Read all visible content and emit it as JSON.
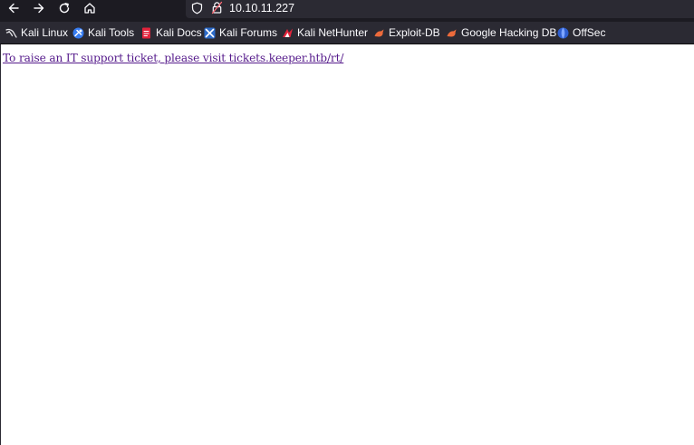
{
  "browser": {
    "url": "10.10.11.227",
    "bookmarks": [
      {
        "label": "Kali Linux",
        "icon": "kali-dragon-icon"
      },
      {
        "label": "Kali Tools",
        "icon": "kali-tools-icon"
      },
      {
        "label": "Kali Docs",
        "icon": "kali-docs-icon"
      },
      {
        "label": "Kali Forums",
        "icon": "kali-forums-icon"
      },
      {
        "label": "Kali NetHunter",
        "icon": "kali-nethunter-icon"
      },
      {
        "label": "Exploit-DB",
        "icon": "exploit-db-icon"
      },
      {
        "label": "Google Hacking DB",
        "icon": "google-hacking-db-icon"
      },
      {
        "label": "OffSec",
        "icon": "offsec-icon"
      }
    ]
  },
  "page": {
    "link_text": "To raise an IT support ticket, please visit tickets.keeper.htb/rt/"
  },
  "colors": {
    "toolbar": "#1c1b22",
    "bookmarks_bar": "#2b2a33",
    "visited_link": "#551a8b"
  }
}
